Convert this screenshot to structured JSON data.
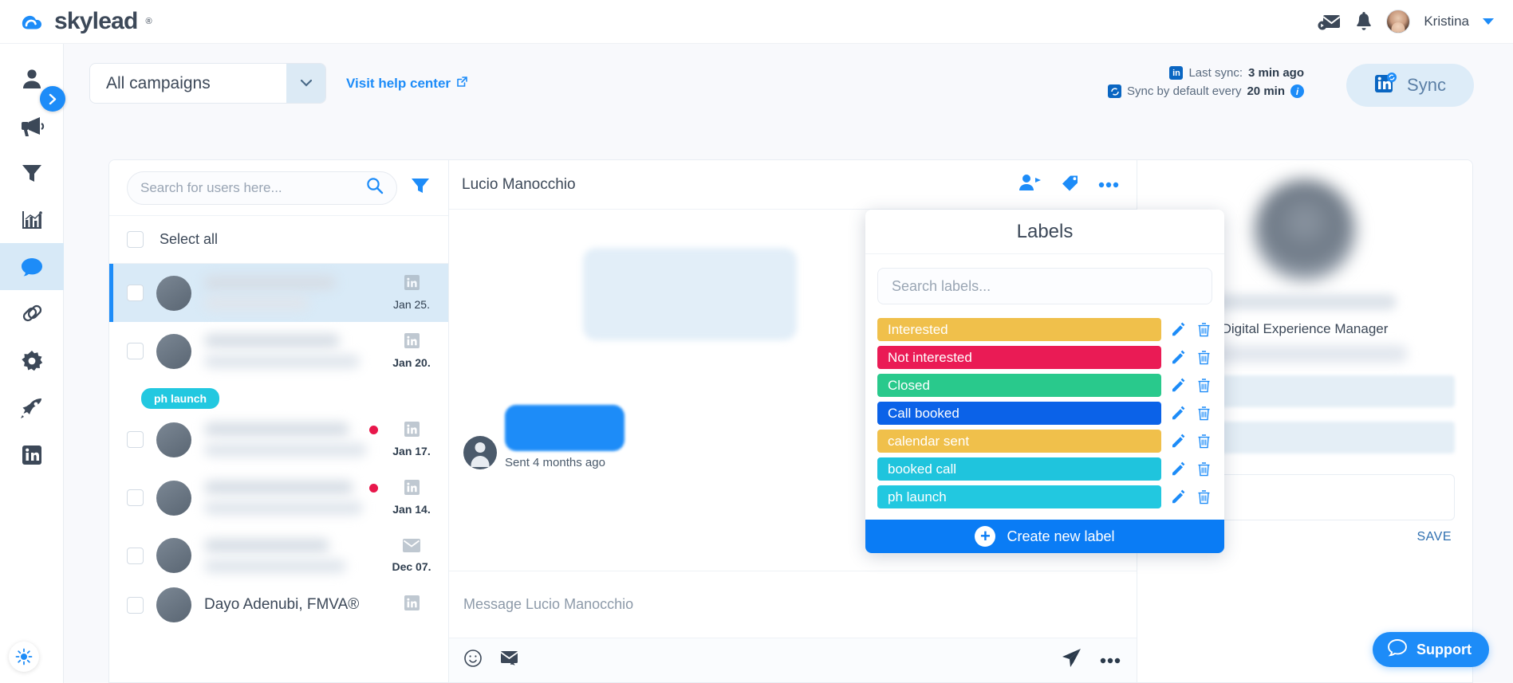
{
  "brand": {
    "name": "skylead",
    "registered": "®",
    "accent": "#1d8cf8"
  },
  "header": {
    "user_name": "Kristina",
    "messages_icon": "mail-forward-icon",
    "notifications_icon": "bell-icon",
    "avatar_icon": "user-avatar",
    "caret_icon": "chevron-down-icon"
  },
  "sidebar": {
    "items": [
      {
        "name": "prospects",
        "icon": "person-icon",
        "active": false
      },
      {
        "name": "campaigns",
        "icon": "megaphone-icon",
        "active": false
      },
      {
        "name": "filters",
        "icon": "funnel-icon",
        "active": false
      },
      {
        "name": "reports",
        "icon": "bar-chart-icon",
        "active": false
      },
      {
        "name": "inbox",
        "icon": "chat-bubble-icon",
        "active": true
      },
      {
        "name": "integrations",
        "icon": "link-icon",
        "active": false
      },
      {
        "name": "settings",
        "icon": "gear-icon",
        "active": false
      },
      {
        "name": "boost",
        "icon": "rocket-icon",
        "active": false
      },
      {
        "name": "linkedin-accounts",
        "icon": "linkedin-icon",
        "active": false
      }
    ],
    "expand_icon": "chevron-right-icon",
    "theme_toggle_icon": "sun-icon"
  },
  "toolbar": {
    "campaign_value": "All campaigns",
    "campaign_caret": "chevron-down-icon",
    "help_label": "Visit help center",
    "help_icon": "external-link-icon"
  },
  "sync": {
    "last_sync_label": "Last sync:",
    "last_sync_value": "3 min ago",
    "default_prefix": "Sync by default every",
    "default_value": "20 min",
    "linkedin_icon": "linkedin-icon",
    "sync_small_icon": "sync-linkedin-icon",
    "info_icon": "info-icon",
    "button_label": "Sync",
    "button_icon": "linkedin-sync-icon"
  },
  "conversations": {
    "search_placeholder": "Search for users here...",
    "search_value": "",
    "search_icon": "search-icon",
    "filter_icon": "filter-icon",
    "select_all_label": "Select all",
    "items": [
      {
        "date": "Jan 25.",
        "source": "linkedin",
        "active": true,
        "unread": false,
        "bold_date": false,
        "tag": ""
      },
      {
        "date": "Jan 20.",
        "source": "linkedin",
        "active": false,
        "unread": false,
        "bold_date": true,
        "tag": ""
      },
      {
        "date": "Jan 17.",
        "source": "linkedin",
        "active": false,
        "unread": true,
        "bold_date": true,
        "tag": "ph launch"
      },
      {
        "date": "Jan 14.",
        "source": "linkedin",
        "active": false,
        "unread": true,
        "bold_date": true,
        "tag": ""
      },
      {
        "date": "Dec 07.",
        "source": "email",
        "active": false,
        "unread": false,
        "bold_date": true,
        "tag": ""
      }
    ],
    "partial_item_name": "Dayo Adenubi, FMVA®"
  },
  "thread": {
    "contact_name": "Lucio Manocchio",
    "add_contact_icon": "add-person-icon",
    "label_icon": "tag-icon",
    "more_icon": "more-horizontal-icon",
    "sent_meta": "Sent 4 months ago",
    "composer_placeholder": "Message Lucio Manocchio",
    "emoji_icon": "emoji-icon",
    "template_icon": "email-template-icon",
    "send_icon": "send-icon",
    "composer_more_icon": "more-horizontal-icon"
  },
  "profile": {
    "role": "Digital Experience Manager",
    "save_label": "SAVE"
  },
  "labels_modal": {
    "title": "Labels",
    "search_placeholder": "Search labels...",
    "search_value": "",
    "edit_icon": "pencil-icon",
    "delete_icon": "trash-icon",
    "create_label": "Create new label",
    "create_icon": "plus-icon",
    "items": [
      {
        "text": "Interested",
        "color": "#f0c04b"
      },
      {
        "text": "Not interested",
        "color": "#ea1b55"
      },
      {
        "text": "Closed",
        "color": "#29c98c"
      },
      {
        "text": "Call booked",
        "color": "#0b62e8"
      },
      {
        "text": "calendar sent",
        "color": "#f0c04b"
      },
      {
        "text": "booked call",
        "color": "#1fc4dd"
      },
      {
        "text": "ph launch",
        "color": "#22c8e0"
      }
    ]
  },
  "support": {
    "label": "Support",
    "icon": "chat-support-icon"
  }
}
